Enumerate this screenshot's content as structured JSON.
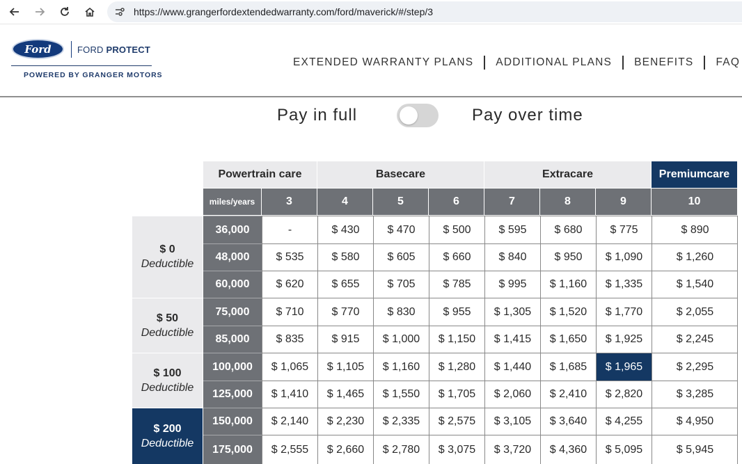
{
  "browser": {
    "url": "https://www.grangerfordextendedwarranty.com/ford/maverick/#/step/3"
  },
  "header": {
    "logo_brand": "Ford",
    "logo_product_light": "FORD ",
    "logo_product_bold": "PROTECT",
    "logo_tagline": "POWERED BY GRANGER MOTORS",
    "nav": [
      "EXTENDED WARRANTY PLANS",
      "ADDITIONAL PLANS",
      "BENEFITS",
      "FAQ"
    ]
  },
  "payment_toggle": {
    "left_label": "Pay in full",
    "right_label": "Pay over time",
    "over_time_selected": false
  },
  "pricing": {
    "plans": [
      "Powertrain care",
      "Basecare",
      "Extracare",
      "Premiumcare"
    ],
    "years_label": "miles/years",
    "years": [
      "3",
      "4",
      "5",
      "6",
      "7",
      "8",
      "9",
      "10"
    ],
    "deductibles": [
      {
        "amount": "$ 0",
        "word": "Deductible"
      },
      {
        "amount": "$ 50",
        "word": "Deductible"
      },
      {
        "amount": "$ 100",
        "word": "Deductible"
      },
      {
        "amount": "$ 200",
        "word": "Deductible"
      }
    ],
    "selected_deductible": "$ 200",
    "rows": [
      {
        "miles": "36,000",
        "prices": [
          "-",
          "$ 430",
          "$ 470",
          "$ 500",
          "$ 595",
          "$ 680",
          "$ 775",
          "$ 890"
        ]
      },
      {
        "miles": "48,000",
        "prices": [
          "$ 535",
          "$ 580",
          "$ 605",
          "$ 660",
          "$ 840",
          "$ 950",
          "$ 1,090",
          "$ 1,260"
        ]
      },
      {
        "miles": "60,000",
        "prices": [
          "$ 620",
          "$ 655",
          "$ 705",
          "$ 785",
          "$ 995",
          "$ 1,160",
          "$ 1,335",
          "$ 1,540"
        ]
      },
      {
        "miles": "75,000",
        "prices": [
          "$ 710",
          "$ 770",
          "$ 830",
          "$ 955",
          "$ 1,305",
          "$ 1,520",
          "$ 1,770",
          "$ 2,055"
        ]
      },
      {
        "miles": "85,000",
        "prices": [
          "$ 835",
          "$ 915",
          "$ 1,000",
          "$ 1,150",
          "$ 1,415",
          "$ 1,650",
          "$ 1,925",
          "$ 2,245"
        ]
      },
      {
        "miles": "100,000",
        "prices": [
          "$ 1,065",
          "$ 1,105",
          "$ 1,160",
          "$ 1,280",
          "$ 1,440",
          "$ 1,685",
          "$ 1,965",
          "$ 2,295"
        ]
      },
      {
        "miles": "125,000",
        "prices": [
          "$ 1,410",
          "$ 1,465",
          "$ 1,550",
          "$ 1,705",
          "$ 2,060",
          "$ 2,410",
          "$ 2,820",
          "$ 3,285"
        ]
      },
      {
        "miles": "150,000",
        "prices": [
          "$ 2,140",
          "$ 2,230",
          "$ 2,335",
          "$ 2,575",
          "$ 3,105",
          "$ 3,640",
          "$ 4,255",
          "$ 4,950"
        ]
      },
      {
        "miles": "175,000",
        "prices": [
          "$ 2,555",
          "$ 2,660",
          "$ 2,780",
          "$ 3,075",
          "$ 3,720",
          "$ 4,360",
          "$ 5,095",
          "$ 5,945"
        ]
      }
    ],
    "selected_price": "$ 1,965"
  },
  "colors": {
    "navy": "#143863",
    "header_gray": "#6e7176",
    "plan_gray": "#eaeaec"
  }
}
